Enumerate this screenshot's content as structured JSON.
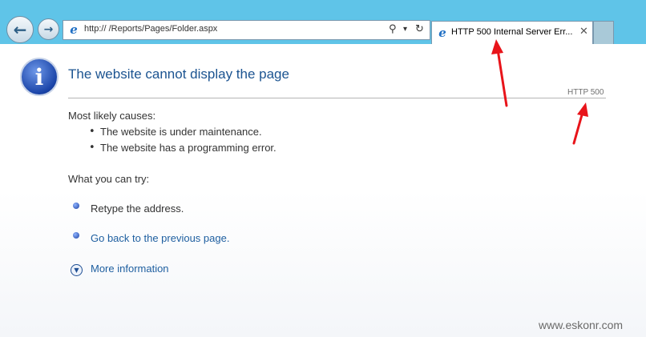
{
  "browser": {
    "address": "http://                /Reports/Pages/Folder.aspx",
    "tab_title": "HTTP 500 Internal Server Err...",
    "back_glyph": "←",
    "forward_glyph": "→",
    "search_glyph": "⚲",
    "dropdown_glyph": "▾",
    "refresh_glyph": "↻",
    "close_glyph": "✕"
  },
  "page": {
    "title": "The website cannot display the page",
    "http_code": "HTTP 500",
    "causes_heading": "Most likely causes:",
    "causes": [
      "The website is under maintenance.",
      "The website has a programming error."
    ],
    "try_heading": "What you can try:",
    "try_items": [
      "Retype the address.",
      "Go back to the previous page."
    ],
    "more_info": "More information"
  },
  "watermark": "www.eskonr.com",
  "colors": {
    "chrome": "#5fc4e8",
    "title": "#1c5491",
    "link": "#1f5fa0",
    "arrow": "#e8141a"
  }
}
